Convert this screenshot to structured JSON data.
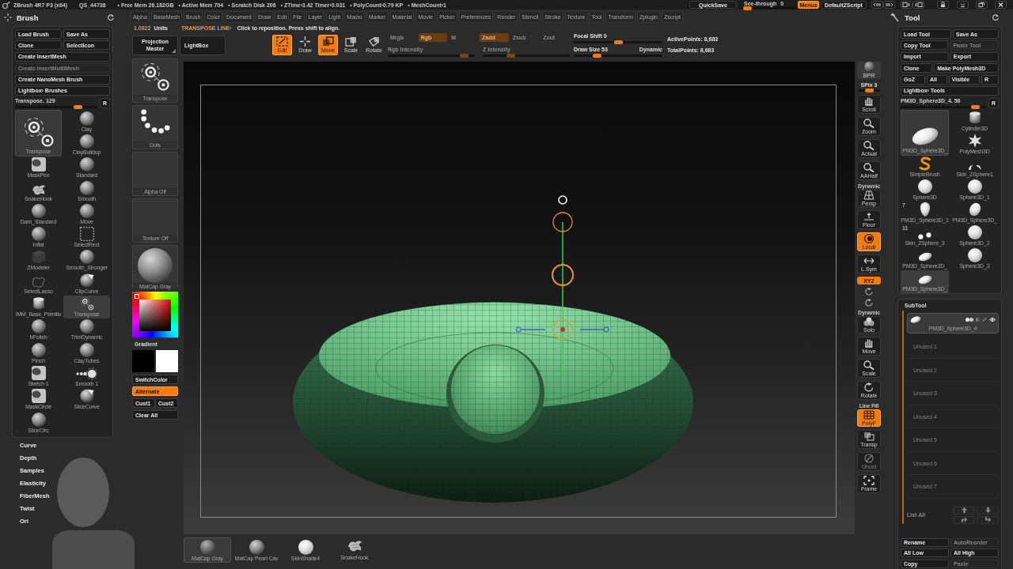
{
  "title_bar": {
    "app": "ZBrush 4R7 P3 (x64)",
    "session": "QS_44738",
    "stats": [
      "• Free Mem 26.182GB",
      "• Active Mem 704",
      "• Scratch Disk 206",
      "• ZTime›3.42 Timer›0.031",
      "• PolyCount›0.79 KP",
      "• MeshCount›1"
    ],
    "quicksave": "QuickSave",
    "see_through": {
      "label": "See-through",
      "value": "0",
      "level": 0.05
    },
    "menus": {
      "label": "Menus",
      "on": true
    },
    "script": "DefaultZScript"
  },
  "brush_palette": {
    "title": "Brush",
    "button_rows": [
      [
        {
          "label": "Load Brush",
          "disabled": false
        },
        {
          "label": "Save As",
          "disabled": false
        }
      ],
      [
        {
          "label": "Clone",
          "disabled": false
        },
        {
          "label": "SelectIcon",
          "disabled": false
        }
      ],
      [
        {
          "label": "Create InsertMesh",
          "disabled": false
        }
      ],
      [
        {
          "label": "Create InsertMultiMesh",
          "disabled": true
        }
      ],
      [
        {
          "label": "Create NanoMesh Brush",
          "disabled": false
        }
      ],
      [
        {
          "label": "Lightbox› Brushes",
          "disabled": false
        }
      ]
    ],
    "slider": {
      "label": "Transpose. 129",
      "level": 0.8
    },
    "reset": "R",
    "current": {
      "label": "Transpose",
      "kind": "transpose"
    },
    "brushes": [
      {
        "label": "Clay",
        "kind": "sphere",
        "selected": false
      },
      {
        "label": "ClayBuildup",
        "kind": "sphere",
        "selected": false
      },
      {
        "label": "MaskPen",
        "kind": "mask",
        "selected": false
      },
      {
        "label": "Standard",
        "kind": "sphere",
        "selected": false
      },
      {
        "label": "SnakeHook",
        "kind": "splash",
        "selected": false
      },
      {
        "label": "Smooth",
        "kind": "sphere",
        "selected": false
      },
      {
        "label": "Dam_Standard",
        "kind": "sphere",
        "selected": false
      },
      {
        "label": "Move",
        "kind": "sphere",
        "selected": false
      },
      {
        "label": "Inflat",
        "kind": "sphere",
        "selected": false
      },
      {
        "label": "SelectRect",
        "kind": "rect",
        "selected": false
      },
      {
        "label": "ZModeler",
        "kind": "cube",
        "selected": false
      },
      {
        "label": "Smooth_Stronger",
        "kind": "sphere",
        "selected": false
      },
      {
        "label": "SelectLasso",
        "kind": "lasso",
        "selected": false
      },
      {
        "label": "ClipCurve",
        "kind": "clip",
        "selected": false
      },
      {
        "label": "IMM_Base_Primitiv",
        "kind": "cylinder",
        "selected": false
      },
      {
        "label": "Transpose",
        "kind": "transpose",
        "selected": true
      },
      {
        "label": "hPolish",
        "kind": "sphere",
        "selected": false
      },
      {
        "label": "TrimDynamic",
        "kind": "sphere",
        "selected": false
      },
      {
        "label": "Pinch",
        "kind": "sphere",
        "selected": false
      },
      {
        "label": "ClayTubes",
        "kind": "sphere",
        "selected": false
      },
      {
        "label": "Sketch 1",
        "kind": "mask",
        "selected": false
      },
      {
        "label": "Smooth 1",
        "kind": "beads",
        "selected": false
      },
      {
        "label": "MaskCircle",
        "kind": "mask",
        "selected": false
      },
      {
        "label": "SliceCurve",
        "kind": "clip",
        "selected": false
      },
      {
        "label": "SliceCirc",
        "kind": "sphere",
        "selected": false
      }
    ],
    "subpalettes": [
      "Curve",
      "Depth",
      "Samples",
      "Elasticity",
      "FiberMesh",
      "Twist",
      "Ori"
    ]
  },
  "menu_bar": [
    "Alpha",
    "BaseMesh",
    "Brush",
    "Color",
    "Document",
    "Draw",
    "Edit",
    "File",
    "Layer",
    "Light",
    "Macro",
    "Marker",
    "Material",
    "Movie",
    "Picker",
    "Preferences",
    "Render",
    "Stencil",
    "Stroke",
    "Texture",
    "Tool",
    "Transform",
    "Zplugin",
    "Zscript"
  ],
  "status_line": {
    "units_value": "1.0822",
    "units_label": "Units",
    "mode": "TRANSPOSE LINE›",
    "hint": "Click to reposition. Press shift to align."
  },
  "top_shelf": {
    "projection_master": "Projection Master",
    "lightbox": "LightBox",
    "modes": [
      {
        "label": "Edit",
        "kind": "edit",
        "on": true
      },
      {
        "label": "Draw",
        "kind": "draw",
        "on": false
      },
      {
        "label": "Move",
        "kind": "move",
        "on": true
      },
      {
        "label": "Scale",
        "kind": "scale",
        "on": false
      },
      {
        "label": "Rotate",
        "kind": "rotate",
        "on": false
      }
    ],
    "paint": {
      "disabled": true,
      "toggles": [
        {
          "label": "Mrgb",
          "on": false
        },
        {
          "label": "Rgb",
          "on": true
        },
        {
          "label": "M",
          "on": false
        },
        {
          "label": "Zadd",
          "on": true
        },
        {
          "label": "Zsub",
          "on": false
        },
        {
          "label": "Zcut",
          "on": false
        }
      ],
      "sliders": [
        {
          "label": "Rgb Intensity",
          "level": 0.92
        },
        {
          "label": "Z Intensity",
          "level": 0.3
        }
      ]
    },
    "focal_shift": {
      "label": "Focal Shift 0",
      "level": 0.5
    },
    "draw_size": {
      "label": "Draw Size 53",
      "level": 0.24
    },
    "dynamic": "Dynamic",
    "points": [
      "ActivePoints: 8,683",
      "TotalPoints: 8,683"
    ]
  },
  "left_shelf": {
    "thumbs": [
      {
        "label": "Transpose",
        "kind": "transpose"
      },
      {
        "label": "Dots",
        "kind": "dots"
      },
      {
        "label": "Alpha Off",
        "kind": "empty"
      },
      {
        "label": "Texture Off",
        "kind": "empty"
      },
      {
        "label": "MatCap Gray",
        "kind": "matcap"
      }
    ],
    "gradient": "Gradient",
    "swatches": [
      {
        "color": "#000000"
      },
      {
        "color": "#ffffff"
      }
    ],
    "buttons": [
      [
        {
          "label": "SwitchColor",
          "on": false
        }
      ],
      [
        {
          "label": "Alternate",
          "on": true
        }
      ],
      [
        {
          "label": "Cust1",
          "on": false
        },
        {
          "label": "Cust2",
          "on": false
        }
      ],
      [
        {
          "label": "Clear All",
          "on": false
        }
      ]
    ]
  },
  "right_shelf": [
    {
      "kind": "bpr",
      "label": "BPR"
    },
    {
      "kind": "slider",
      "label": "SPix 3",
      "level": 0.55
    },
    {
      "kind": "scroll",
      "label": "Scroll",
      "on": false,
      "disabled": false
    },
    {
      "kind": "zoom",
      "label": "Zoom",
      "on": false,
      "disabled": false
    },
    {
      "kind": "actual",
      "label": "Actual",
      "on": false,
      "disabled": false
    },
    {
      "kind": "aahalf",
      "label": "AAHalf",
      "on": false,
      "disabled": false
    },
    {
      "kind": "persp",
      "caption": "Dynamic",
      "label": "Persp",
      "on": false,
      "disabled": false
    },
    {
      "kind": "floor",
      "label": "Floor",
      "on": false,
      "disabled": false
    },
    {
      "kind": "local",
      "label": "Local",
      "on": true,
      "disabled": false
    },
    {
      "kind": "lsym",
      "label": "L.Sym",
      "on": false,
      "disabled": false
    },
    {
      "kind": "toggle",
      "label": "XYZ",
      "on": true
    },
    {
      "kind": "spin"
    },
    {
      "kind": "spin"
    },
    {
      "kind": "solo",
      "caption": "Dynamic",
      "label": "Solo",
      "on": false,
      "disabled": false
    },
    {
      "kind": "move",
      "label": "Move",
      "on": false,
      "disabled": false
    },
    {
      "kind": "scale",
      "label": "Scale",
      "on": false,
      "disabled": false
    },
    {
      "kind": "rotate",
      "label": "Rotate",
      "on": false,
      "disabled": false
    },
    {
      "kind": "polyf",
      "caption": "Line Fill",
      "label": "PolyF",
      "on": true,
      "disabled": false
    },
    {
      "kind": "transp",
      "label": "Transp",
      "on": false,
      "disabled": false
    },
    {
      "kind": "ghost",
      "label": "Ghost",
      "on": false,
      "disabled": true
    },
    {
      "kind": "frame",
      "label": "Frame",
      "on": false,
      "disabled": false
    }
  ],
  "materials": [
    {
      "label": "MatCap Gray",
      "kind": "dark_sphere",
      "selected": true
    },
    {
      "label": "MatCap Pearl Cav",
      "kind": "sphere",
      "selected": false
    },
    {
      "label": "SkinShade4",
      "kind": "white_sphere",
      "selected": false
    },
    {
      "label": "SnakeHook",
      "kind": "splash",
      "selected": false
    }
  ],
  "tool_palette": {
    "title": "Tool",
    "button_rows": [
      [
        {
          "label": "Load Tool",
          "disabled": false
        },
        {
          "label": "Save As",
          "disabled": false
        }
      ],
      [
        {
          "label": "Copy Tool",
          "disabled": false
        },
        {
          "label": "Paste Tool",
          "disabled": true
        }
      ],
      [
        {
          "label": "Import",
          "disabled": false
        },
        {
          "label": "Export",
          "disabled": false
        }
      ],
      [
        {
          "label": "Clone",
          "disabled": false
        },
        {
          "label": "Make PolyMesh3D",
          "disabled": false
        }
      ],
      [
        {
          "label": "GoZ",
          "disabled": false
        },
        {
          "label": "All",
          "disabled": false
        },
        {
          "label": "Visible",
          "disabled": false
        },
        {
          "label": "R",
          "disabled": false
        }
      ],
      [
        {
          "label": "Lightbox› Tools",
          "disabled": false
        }
      ]
    ],
    "slider": {
      "label": "PM3D_Sphere3D_4. 56",
      "level": 0.92
    },
    "reset": "R",
    "current": {
      "label": "PM3D_Sphere3D_",
      "kind": "disc"
    },
    "tools": [
      {
        "label": "Cylinder3D",
        "kind": "cylinder",
        "selected": false
      },
      {
        "label": "PolyMesh3D",
        "kind": "star",
        "selected": false
      },
      {
        "label": "SimpleBrush",
        "kind": "swirl",
        "selected": false
      },
      {
        "label": "Skin_ZSphere1",
        "kind": "crescents",
        "selected": false
      },
      {
        "label": "Sphere3D",
        "kind": "white_sphere",
        "selected": false
      },
      {
        "label": "Sphere3D_1",
        "kind": "white_sphere",
        "selected": false
      },
      {
        "label": "PM3D_Sphere3D_1",
        "kind": "head",
        "count": "7",
        "selected": false
      },
      {
        "label": "PM3D_Sphere3D_",
        "kind": "egg",
        "selected": false
      },
      {
        "label": "Skin_ZSphere_3",
        "kind": "pair",
        "count": "11",
        "selected": false
      },
      {
        "label": "Sphere3D_2",
        "kind": "white_sphere",
        "selected": false
      },
      {
        "label": "PM3D_Sphere3D_",
        "kind": "disc",
        "selected": false
      },
      {
        "label": "Sphere3D_3",
        "kind": "white_sphere",
        "selected": false
      },
      {
        "label": "PM3D_Sphere3D_",
        "kind": "disc",
        "selected": true
      }
    ],
    "subtool": {
      "title": "SubTool",
      "items": [
        {
          "label": "PM3D_Sphere3D_4",
          "kind": "mesh",
          "selected": true
        },
        {
          "label": "Unused 1",
          "kind": "empty",
          "selected": false
        },
        {
          "label": "Unused 2",
          "kind": "empty",
          "selected": false
        },
        {
          "label": "Unused 3",
          "kind": "empty",
          "selected": false
        },
        {
          "label": "Unused 4",
          "kind": "empty",
          "selected": false
        },
        {
          "label": "Unused 5",
          "kind": "empty",
          "selected": false
        },
        {
          "label": "Unused 6",
          "kind": "empty",
          "selected": false
        },
        {
          "label": "Unused 7",
          "kind": "empty",
          "selected": false
        }
      ],
      "list_all": "List All",
      "buttons": [
        [
          {
            "label": "Rename",
            "disabled": false
          },
          {
            "label": "AutoReorder",
            "disabled": true
          }
        ],
        [
          {
            "label": "All Low",
            "disabled": false
          },
          {
            "label": "All High",
            "disabled": false
          }
        ],
        [
          {
            "label": "Copy",
            "disabled": false
          },
          {
            "label": "Paste",
            "disabled": true
          }
        ]
      ]
    }
  }
}
